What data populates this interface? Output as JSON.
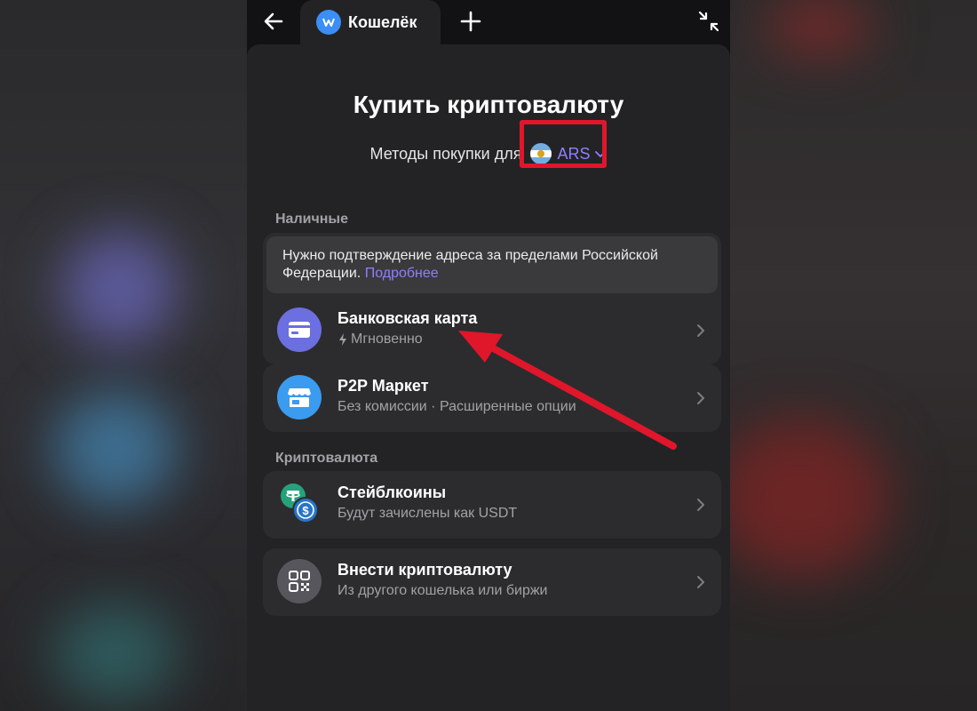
{
  "topbar": {
    "tab_title": "Кошелёк"
  },
  "page": {
    "title": "Купить криптовалюту",
    "method_label": "Методы покупки для",
    "currency_code": "ARS"
  },
  "sections": {
    "cash_label": "Наличные",
    "crypto_label": "Криптовалюта"
  },
  "notice": {
    "text": "Нужно подтверждение адреса за пределами Российской Федерации.",
    "link": "Подробнее"
  },
  "methods": {
    "bank_card": {
      "title": "Банковская карта",
      "subtitle": "Мгновенно"
    },
    "p2p": {
      "title": "P2P Маркет",
      "subtitle": "Без комиссии · Расширенные опции"
    },
    "stablecoins": {
      "title": "Стейблкоины",
      "subtitle": "Будут зачислены как USDT"
    },
    "deposit": {
      "title": "Внести криптовалюту",
      "subtitle": "Из другого кошелька или биржи"
    }
  },
  "colors": {
    "accent": "#8f7fff",
    "highlight": "#e0162b",
    "bank_icon": "#6b6fe0",
    "p2p_icon": "#3b9bf0",
    "deposit_icon": "#56565c"
  },
  "icons": {
    "back": "arrow-left-icon",
    "wallet": "wallet-logo-icon",
    "plus": "plus-icon",
    "collapse": "collapse-icon",
    "card": "credit-card-icon",
    "store": "store-icon",
    "tether": "tether-icon",
    "usdc": "usdc-icon",
    "qr": "qr-code-icon",
    "bolt": "lightning-icon",
    "chevron": "chevron-right-icon"
  }
}
